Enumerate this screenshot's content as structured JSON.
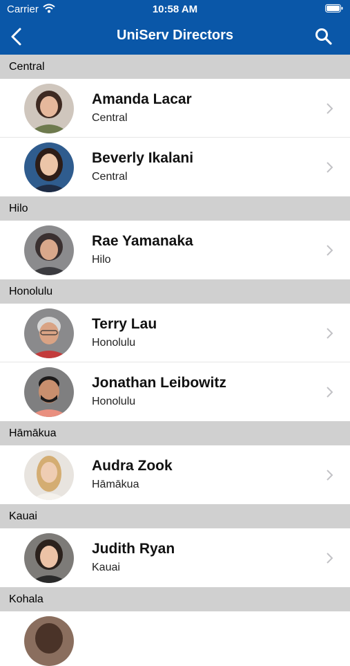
{
  "status_bar": {
    "carrier": "Carrier",
    "time": "10:58 AM"
  },
  "nav": {
    "title": "UniServ Directors"
  },
  "sections": [
    {
      "label": "Central",
      "rows": [
        {
          "name": "Amanda Lacar",
          "region": "Central"
        },
        {
          "name": "Beverly Ikalani",
          "region": "Central"
        }
      ]
    },
    {
      "label": "Hilo",
      "rows": [
        {
          "name": "Rae Yamanaka",
          "region": "Hilo"
        }
      ]
    },
    {
      "label": "Honolulu",
      "rows": [
        {
          "name": "Terry Lau",
          "region": "Honolulu"
        },
        {
          "name": "Jonathan Leibowitz",
          "region": "Honolulu"
        }
      ]
    },
    {
      "label": "Hāmākua",
      "rows": [
        {
          "name": "Audra Zook",
          "region": "Hāmākua"
        }
      ]
    },
    {
      "label": "Kauai",
      "rows": [
        {
          "name": "Judith Ryan",
          "region": "Kauai"
        }
      ]
    },
    {
      "label": "Kohala",
      "rows": []
    }
  ],
  "colors": {
    "header_bg": "#0a57a8",
    "section_bg": "#d0d0d0"
  },
  "icons": {
    "back": "chevron-left-icon",
    "search": "search-icon",
    "row_disclosure": "chevron-right-icon"
  }
}
